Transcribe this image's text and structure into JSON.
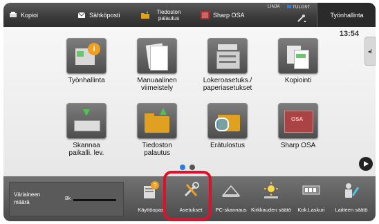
{
  "topbar": {
    "tabs": [
      {
        "label": "Kopioi",
        "icon": "copy-icon"
      },
      {
        "label": "Sähköposti",
        "icon": "email-icon"
      },
      {
        "label": "Tiedoston palautus",
        "icon": "folder-retrieve-icon"
      },
      {
        "label": "Sharp OSA",
        "icon": "sharp-osa-icon"
      }
    ],
    "status_line": "LINJA",
    "status_print": "TULOST.",
    "job_button": "Työnhallinta"
  },
  "clock": "13:54",
  "side_tab": "◂I",
  "apps": [
    {
      "label": "Työnhallinta",
      "icon": "job-status-icon"
    },
    {
      "label": "Manuaalinen viimeistely",
      "icon": "manual-finishing-icon"
    },
    {
      "label": "Lokeroasetuks./ paperiasetukset",
      "icon": "tray-settings-icon"
    },
    {
      "label": "Kopiointi",
      "icon": "copy-doc-icon"
    },
    {
      "label": "Skannaa paikalli. lev.",
      "icon": "scan-local-icon"
    },
    {
      "label": "Tiedoston palautus",
      "icon": "file-retrieve-icon"
    },
    {
      "label": "Erätulostus",
      "icon": "batch-print-icon"
    },
    {
      "label": "Sharp OSA",
      "icon": "sharp-osa-tile-icon"
    }
  ],
  "pagination": {
    "current": 1,
    "total": 2,
    "active_color": "#2a7de1",
    "inactive_color": "#555555"
  },
  "toner": {
    "label": "Väriaineen määrä",
    "channel": "Bk"
  },
  "dock": [
    {
      "label": "Käyttöopas",
      "icon": "manual-guide-icon"
    },
    {
      "label": "Asetukset",
      "icon": "settings-tools-icon"
    },
    {
      "label": "PC-skannaus",
      "icon": "pc-scan-icon"
    },
    {
      "label": "Kirkkauden säätö",
      "icon": "brightness-icon"
    },
    {
      "label": "Kok.Laskuri",
      "icon": "counter-icon"
    },
    {
      "label": "Laitteen säätö",
      "icon": "device-adjust-icon"
    }
  ],
  "highlight_color": "#e0102a"
}
